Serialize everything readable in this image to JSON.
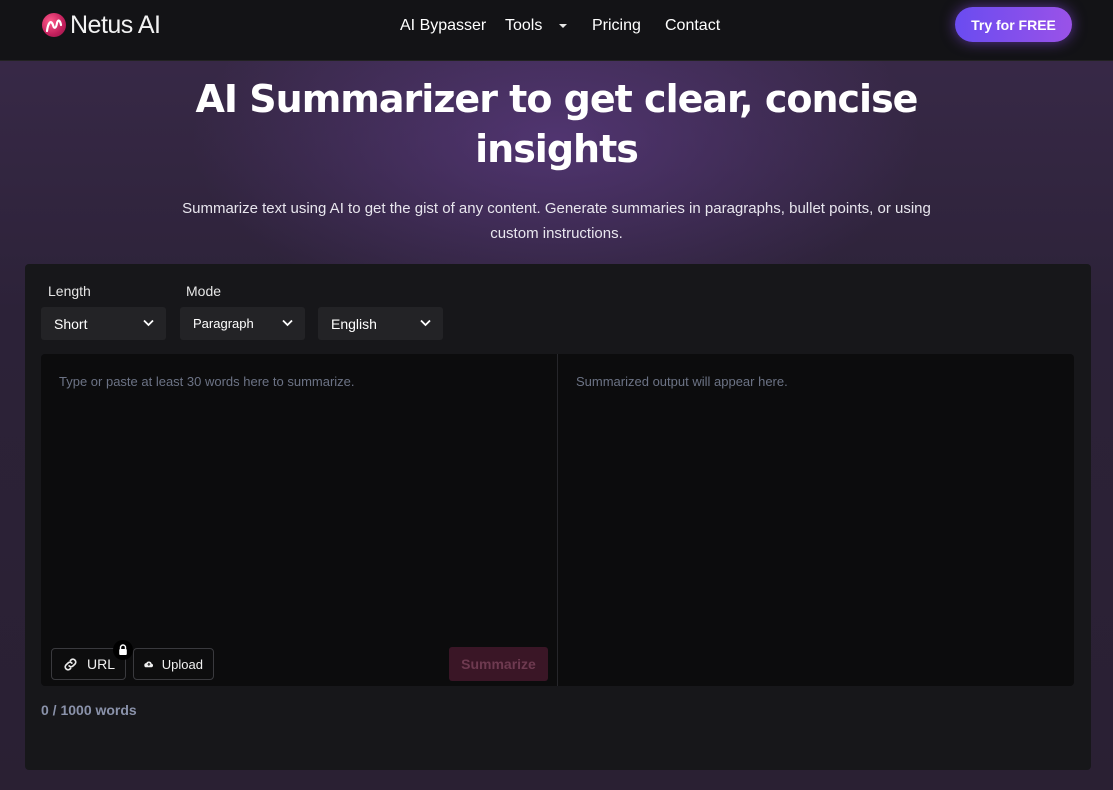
{
  "brand": {
    "name": "Netus AI"
  },
  "nav": {
    "items": [
      {
        "label": "AI Bypasser"
      },
      {
        "label": "Tools"
      },
      {
        "label": "Pricing"
      },
      {
        "label": "Contact"
      }
    ],
    "cta_label": "Try for FREE"
  },
  "hero": {
    "title": "AI Summarizer to get clear, concise insights",
    "subtitle": "Summarize text using AI to get the gist of any content. Generate summaries in paragraphs, bullet points, or using custom instructions."
  },
  "controls": {
    "length_label": "Length",
    "length_value": "Short",
    "mode_label": "Mode",
    "mode_value": "Paragraph",
    "language_value": "English"
  },
  "editor": {
    "input_placeholder": "Type or paste at least 30 words here to summarize.",
    "output_placeholder": "Summarized output will appear here.",
    "url_label": "URL",
    "upload_label": "Upload",
    "summarize_label": "Summarize",
    "word_count": "0 / 1000 words"
  },
  "colors": {
    "accent_gradient_start": "#6a4cf0",
    "accent_gradient_end": "#9a52e8",
    "summarize_disabled_bg": "#3a1626",
    "logo": "#c21f5c"
  },
  "icons": {
    "tools_dropdown": "chevron-down-icon",
    "select_chevron": "chevron-down-icon",
    "url": "link-icon",
    "lock": "lock-icon",
    "upload": "cloud-upload-icon"
  }
}
